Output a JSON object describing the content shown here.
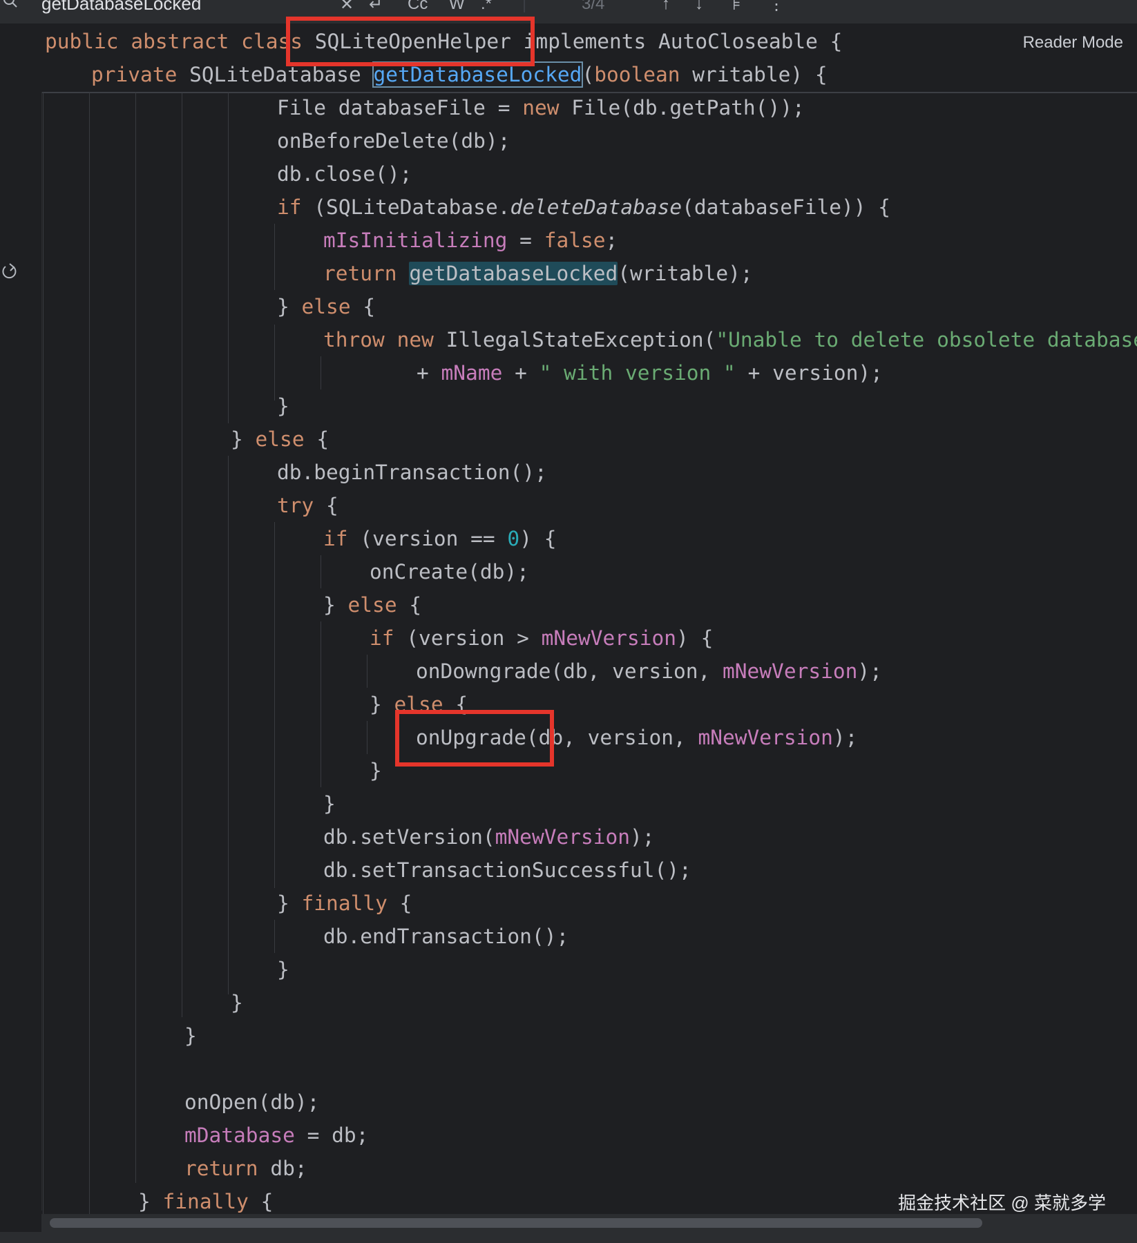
{
  "search": {
    "query": "getDatabaseLocked",
    "matches": "3/4"
  },
  "toolbar": {
    "case_label": "Cc",
    "word_label": "W",
    "regex_label": ".*"
  },
  "reader_mode": "Reader Mode",
  "watermark": "掘金技术社区 @ 菜就多学",
  "colors": {
    "background": "#1e1f22",
    "keyword": "#cf8e6d",
    "field": "#c77dbb",
    "string": "#6aab73",
    "number": "#2aacb8",
    "annotation_box": "#e5352b",
    "search_highlight": "#1f4b59"
  },
  "sticky": {
    "class_prefix": "public abstract class ",
    "class_name": "SQLiteOpenHelper",
    "class_suffix": " implements AutoCloseable {",
    "method_prefix_kw": "private",
    "method_prefix_type": " SQLiteDatabase ",
    "method_name": "getDatabaseLocked",
    "method_params_open": "(",
    "method_params_kw": "boolean",
    "method_params_rest": " writable) {"
  },
  "code": {
    "l1a": "File databaseFile = ",
    "l1b": "new",
    "l1c": " File(db.getPath());",
    "l2": "onBeforeDelete(db);",
    "l3": "db.close();",
    "l4a": "if",
    "l4b": " (SQLiteDatabase.",
    "l4c": "deleteDatabase",
    "l4d": "(databaseFile)) {",
    "l5a": "mIsInitializing",
    "l5b": " = ",
    "l5c": "false",
    "l5d": ";",
    "l6a": "return",
    "l6b": " ",
    "l6c": "getDatabaseLocked",
    "l6d": "(writable);",
    "l7a": "} ",
    "l7b": "else",
    "l7c": " {",
    "l8a": "throw",
    "l8b": " ",
    "l8c": "new",
    "l8d": " IllegalStateException(",
    "l8e": "\"Unable to delete obsolete database \"",
    "l9a": "+ ",
    "l9b": "mName",
    "l9c": " + ",
    "l9d": "\" with version \"",
    "l9e": " + version);",
    "l10": "}",
    "l11a": "} ",
    "l11b": "else",
    "l11c": " {",
    "l12": "db.beginTransaction();",
    "l13a": "try",
    "l13b": " {",
    "l14a": "if",
    "l14b": " (version == ",
    "l14c": "0",
    "l14d": ") {",
    "l15": "onCreate(db);",
    "l16a": "} ",
    "l16b": "else",
    "l16c": " {",
    "l17a": "if",
    "l17b": " (version > ",
    "l17c": "mNewVersion",
    "l17d": ") {",
    "l18a": "onDowngrade(db, version, ",
    "l18b": "mNewVersion",
    "l18c": ");",
    "l19a": "} ",
    "l19b": "else",
    "l19c": " {",
    "l20a": "onUpgrade(db, version, ",
    "l20b": "mNewVersion",
    "l20c": ");",
    "l21": "}",
    "l22": "}",
    "l23a": "db.setVersion(",
    "l23b": "mNewVersion",
    "l23c": ");",
    "l24": "db.setTransactionSuccessful();",
    "l25a": "} ",
    "l25b": "finally",
    "l25c": " {",
    "l26": "db.endTransaction();",
    "l27": "}",
    "l28": "}",
    "l29": "}",
    "l30": "onOpen(db);",
    "l31a": "mDatabase",
    "l31b": " = db;",
    "l32a": "return",
    "l32b": " db;",
    "l33a": "} ",
    "l33b": "finally",
    "l33c": " {"
  }
}
